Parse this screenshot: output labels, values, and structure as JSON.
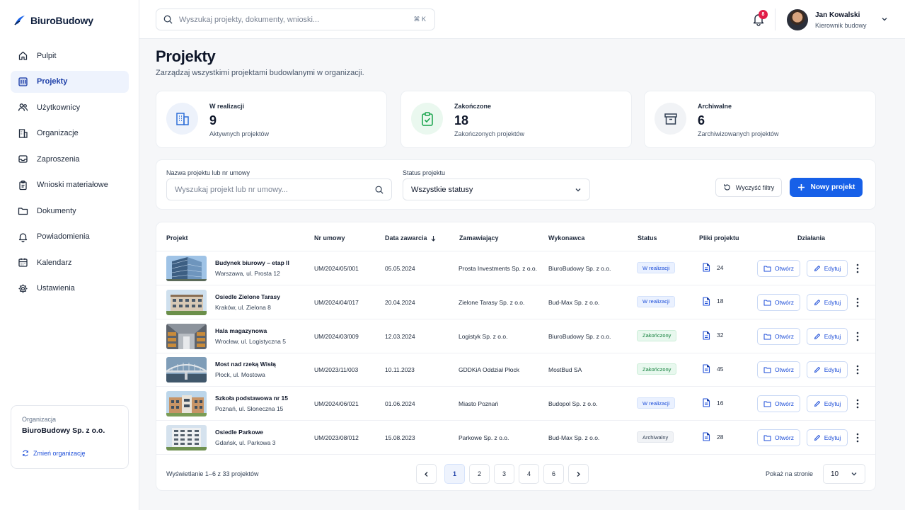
{
  "app": {
    "name": "BiuroBudowy"
  },
  "sidebar": {
    "items": [
      {
        "label": "Pulpit",
        "icon": "home-icon"
      },
      {
        "label": "Projekty",
        "icon": "projects-icon",
        "active": true
      },
      {
        "label": "Użytkownicy",
        "icon": "users-icon"
      },
      {
        "label": "Organizacje",
        "icon": "building-icon"
      },
      {
        "label": "Zaproszenia",
        "icon": "inbox-icon"
      },
      {
        "label": "Wnioski materiałowe",
        "icon": "clipboard-icon"
      },
      {
        "label": "Dokumenty",
        "icon": "folder-icon"
      },
      {
        "label": "Powiadomienia",
        "icon": "bell-icon"
      },
      {
        "label": "Kalendarz",
        "icon": "calendar-icon"
      },
      {
        "label": "Ustawienia",
        "icon": "gear-icon"
      }
    ],
    "org": {
      "label": "Organizacja",
      "name": "BiuroBudowy Sp. z o.o.",
      "change": "Zmień organizację"
    }
  },
  "header": {
    "search_placeholder": "Wyszukaj projekty, dokumenty, wnioski...",
    "shortcut": "⌘ K",
    "notifications": "8",
    "user": {
      "name": "Jan Kowalski",
      "role": "Kierownik budowy"
    }
  },
  "page": {
    "title": "Projekty",
    "subtitle": "Zarządzaj wszystkimi projektami budowlanymi w organizacji."
  },
  "stats": [
    {
      "label": "W realizacji",
      "value": "9",
      "desc": "Aktywnych projektów",
      "color": "#2f6fd8"
    },
    {
      "label": "Zakończone",
      "value": "18",
      "desc": "Zakończonych projektów",
      "color": "#16a34a"
    },
    {
      "label": "Archiwalne",
      "value": "6",
      "desc": "Zarchiwizowanych projektów",
      "color": "#475569"
    }
  ],
  "filters": {
    "name_label": "Nazwa projektu lub nr umowy",
    "name_placeholder": "Wyszukaj projekt lub nr umowy...",
    "status_label": "Status projektu",
    "status_value": "Wszystkie statusy",
    "clear": "Wyczyść filtry",
    "new": "Nowy projekt"
  },
  "table": {
    "columns": [
      "Projekt",
      "Nr umowy",
      "Data zawarcia",
      "Zamawiający",
      "Wykonawca",
      "Status",
      "Pliki projektu",
      "Działania"
    ],
    "open_label": "Otwórz",
    "edit_label": "Edytuj",
    "rows": [
      {
        "name": "Budynek biurowy – etap II",
        "address": "Warszawa, ul. Prosta 12",
        "contract": "UM/2024/05/001",
        "date": "05.05.2024",
        "client": "Prosta Investments Sp. z o.o.",
        "contractor": "BiuroBudowy Sp. z o.o.",
        "status": "W realizacji",
        "status_type": "blue",
        "files": "24",
        "thumb": "glass"
      },
      {
        "name": "Osiedle Zielone Tarasy",
        "address": "Kraków, ul. Zielona 8",
        "contract": "UM/2024/04/017",
        "date": "20.04.2024",
        "client": "Zielone Tarasy Sp. z o.o.",
        "contractor": "Bud-Max Sp. z o.o.",
        "status": "W realizacji",
        "status_type": "blue",
        "files": "18",
        "thumb": "residential"
      },
      {
        "name": "Hala magazynowa",
        "address": "Wrocław, ul. Logistyczna 5",
        "contract": "UM/2024/03/009",
        "date": "12.03.2024",
        "client": "Logistyk Sp. z o.o.",
        "contractor": "BiuroBudowy Sp. z o.o.",
        "status": "Zakończony",
        "status_type": "green",
        "files": "32",
        "thumb": "warehouse"
      },
      {
        "name": "Most nad rzeką Wisłą",
        "address": "Płock, ul. Mostowa",
        "contract": "UM/2023/11/003",
        "date": "10.11.2023",
        "client": "GDDKiA Oddział Płock",
        "contractor": "MostBud SA",
        "status": "Zakończony",
        "status_type": "green",
        "files": "45",
        "thumb": "bridge"
      },
      {
        "name": "Szkoła podstawowa nr 15",
        "address": "Poznań, ul. Słoneczna 15",
        "contract": "UM/2024/06/021",
        "date": "01.06.2024",
        "client": "Miasto Poznań",
        "contractor": "Budopol Sp. z o.o.",
        "status": "W realizacji",
        "status_type": "blue",
        "files": "16",
        "thumb": "school"
      },
      {
        "name": "Osiedle Parkowe",
        "address": "Gdańsk, ul. Parkowa 3",
        "contract": "UM/2023/08/012",
        "date": "15.08.2023",
        "client": "Parkowe Sp. z o.o.",
        "contractor": "Bud-Max Sp. z o.o.",
        "status": "Archiwalny",
        "status_type": "gray",
        "files": "28",
        "thumb": "block"
      }
    ]
  },
  "pagination": {
    "info": "Wyświetlanie 1–6 z 33 projektów",
    "pages": [
      "1",
      "2",
      "3",
      "4",
      "6"
    ],
    "current": "1",
    "per_page_label": "Pokaż na stronie",
    "per_page": "10"
  }
}
